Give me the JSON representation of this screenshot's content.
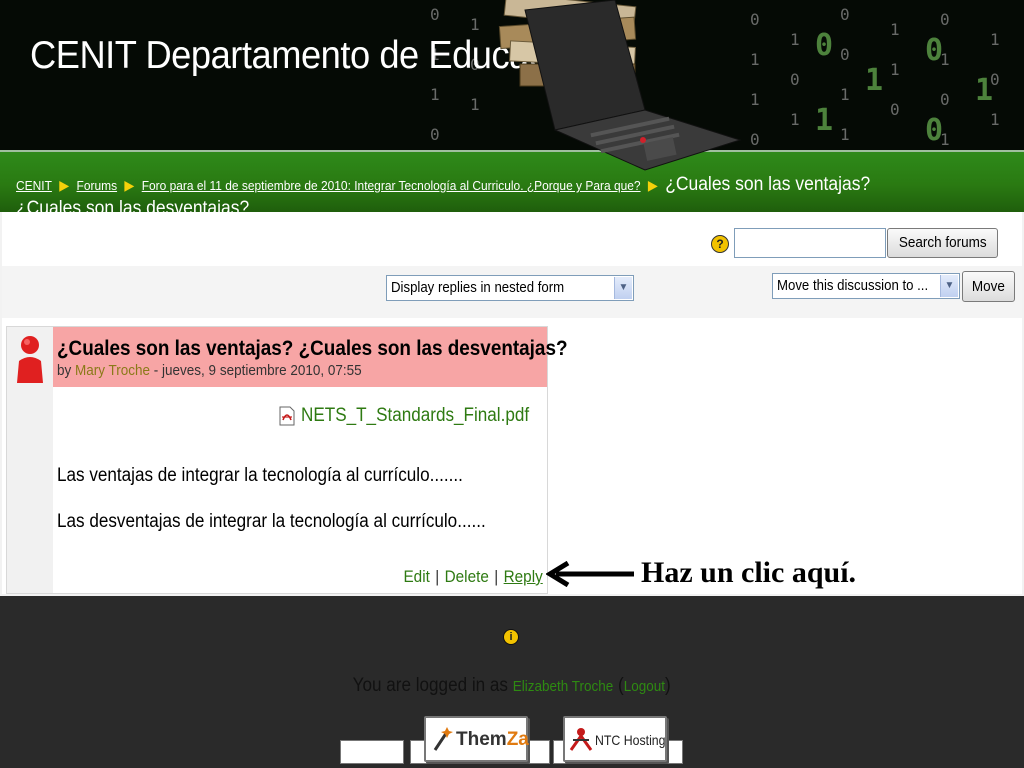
{
  "header": {
    "site_title": "CENIT Departamento de Educación"
  },
  "breadcrumb": {
    "items": [
      "CENIT",
      "Forums",
      "Foro para el 11 de septiembre de 2010: Integrar Tecnología al Curriculo. ¿Porque y Para que?"
    ],
    "current_line1": "¿Cuales son las ventajas?",
    "current_line2": "¿Cuales son las desventajas?"
  },
  "search": {
    "value": "",
    "button_label": "Search forums"
  },
  "controls": {
    "display_mode": "Display replies in nested form",
    "move_select": "Move this discussion to ...",
    "move_button": "Move"
  },
  "post": {
    "subject": "¿Cuales son las ventajas? ¿Cuales son las desventajas?",
    "by_prefix": "by ",
    "author": "Mary Troche",
    "date_text": " - jueves, 9 septiembre 2010, 07:55",
    "attachment": "NETS_T_Standards_Final.pdf",
    "line1": "Las ventajas de integrar la tecnología al currículo.......",
    "line2": "Las desventajas de integrar la tecnología al currículo......",
    "commands": {
      "edit": "Edit",
      "delete": "Delete",
      "reply": "Reply",
      "separator": "|"
    }
  },
  "annotation": {
    "text": "Haz un clic aquí."
  },
  "footer": {
    "logged_in_prefix": "You are logged in as ",
    "user": "Elizabeth Troche",
    "logout": "Logout",
    "badges": {
      "themza_a": "Them",
      "themza_b": "Za",
      "ntc": "NTC Hosting"
    }
  },
  "colors": {
    "nav_green": "#2a7a12",
    "post_header": "#f7a5a5",
    "link_green": "#2e7a12",
    "footer_bg": "#2a2a2a"
  },
  "icons": {
    "help": "help-icon",
    "info": "info-icon",
    "breadcrumb_separator": "triangle-right-icon",
    "user": "user-avatar-icon",
    "pdf": "pdf-icon"
  }
}
